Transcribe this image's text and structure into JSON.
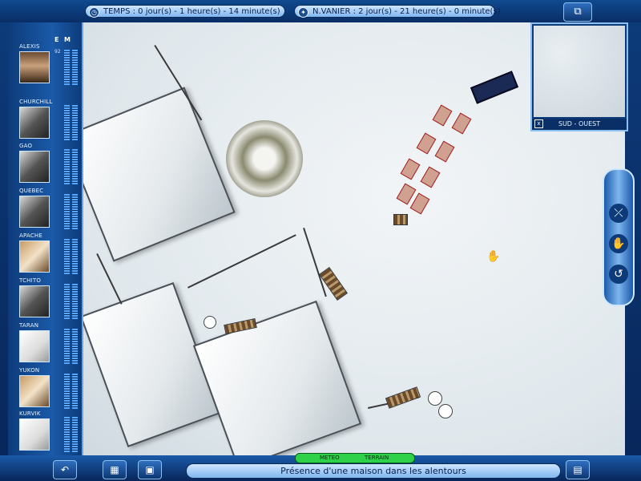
{
  "top": {
    "time_text": "TEMPS : 0 jour(s) - 1 heure(s) - 14 minute(s)",
    "destination_text": "N.VANIER : 2 jour(s) - 21 heure(s) - 0 minute(s)"
  },
  "roster_header": {
    "e": "E",
    "m": "M"
  },
  "dogs": [
    {
      "name": "ALEXIS",
      "e": "92",
      "m": "95"
    },
    {
      "name": "CHURCHILL",
      "e": "80",
      "m": "60"
    },
    {
      "name": "GAO",
      "e": "93",
      "m": "65"
    },
    {
      "name": "QUEBEC",
      "e": "80",
      "m": "90"
    },
    {
      "name": "APACHE",
      "e": "66",
      "m": "75"
    },
    {
      "name": "TCHITO",
      "e": "90",
      "m": "75"
    },
    {
      "name": "TARAN",
      "e": "77",
      "m": "80"
    },
    {
      "name": "YUKON",
      "e": "70",
      "m": "70"
    },
    {
      "name": "KURVIK",
      "e": "43",
      "m": "100"
    }
  ],
  "minimap": {
    "label": "SUD - OUEST",
    "close": "x"
  },
  "bottom": {
    "tab_meteo": "METEO",
    "tab_terrain": "TERRAIN",
    "message": "Présence d'une maison dans les alentours"
  },
  "icons": {
    "time": "clock-icon",
    "destination": "compass-icon",
    "window": "window-toggle-icon",
    "tool1": "ski-icon",
    "tool2": "hand-icon",
    "tool3": "rotate-icon",
    "b1": "undo-icon",
    "b2": "calendar-icon",
    "b3": "save-icon",
    "b4": "book-icon"
  }
}
